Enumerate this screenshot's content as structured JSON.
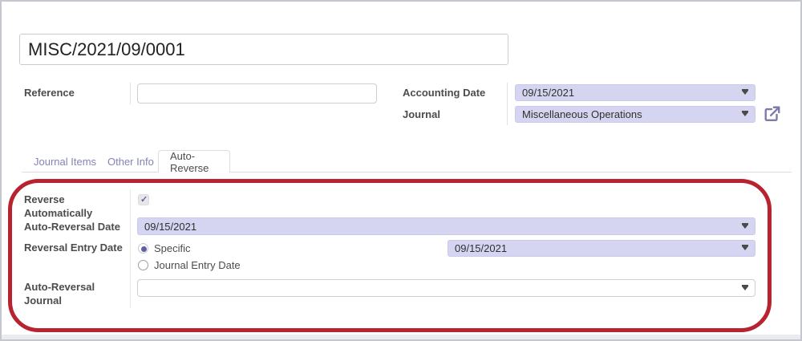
{
  "form": {
    "name_value": "MISC/2021/09/0001",
    "reference": {
      "label": "Reference",
      "value": ""
    },
    "accounting_date": {
      "label": "Accounting Date",
      "value": "09/15/2021"
    },
    "journal": {
      "label": "Journal",
      "value": "Miscellaneous Operations"
    }
  },
  "tabs": [
    {
      "label": "Journal Items",
      "active": false
    },
    {
      "label": "Other Info",
      "active": false
    },
    {
      "label": "Auto-Reverse",
      "active": true
    }
  ],
  "auto_reverse_tab": {
    "reverse_automatically": {
      "label": "Reverse Automatically",
      "checked": true
    },
    "auto_reversal_date": {
      "label": "Auto-Reversal Date",
      "value": "09/15/2021"
    },
    "reversal_entry_date": {
      "label": "Reversal Entry Date",
      "options": [
        {
          "label": "Specific",
          "selected": true
        },
        {
          "label": "Journal Entry Date",
          "selected": false
        }
      ],
      "specific_date_value": "09/15/2021"
    },
    "auto_reversal_journal": {
      "label": "Auto-Reversal Journal",
      "value": ""
    }
  },
  "icons": {
    "dropdown_caret": "caret-down-icon",
    "external_link": "external-link-icon"
  },
  "colors": {
    "accent_purple": "#7C7BAD",
    "field_highlight": "#D5D5F2",
    "annotation_red": "#B7232F"
  }
}
